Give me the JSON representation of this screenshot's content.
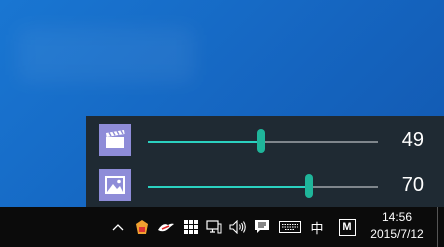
{
  "volume_mixer": {
    "rows": [
      {
        "app": "video-app",
        "icon": "clapperboard-icon",
        "volume": 49
      },
      {
        "app": "photos-app",
        "icon": "image-icon",
        "volume": 70
      }
    ],
    "accent_color": "#2bd1c0",
    "icon_color": "#8e8cd8"
  },
  "taskbar": {
    "tray_icons": [
      "chevron-up-icon",
      "antivirus-icon",
      "tray-app-icon",
      "app-grid-icon",
      "network-icon",
      "speaker-icon",
      "action-center-icon",
      "touch-keyboard-icon",
      "ime-icon",
      "m-app-icon"
    ],
    "ime_label": "中",
    "m_label": "M",
    "time": "14:56",
    "date": "2015/7/12"
  }
}
